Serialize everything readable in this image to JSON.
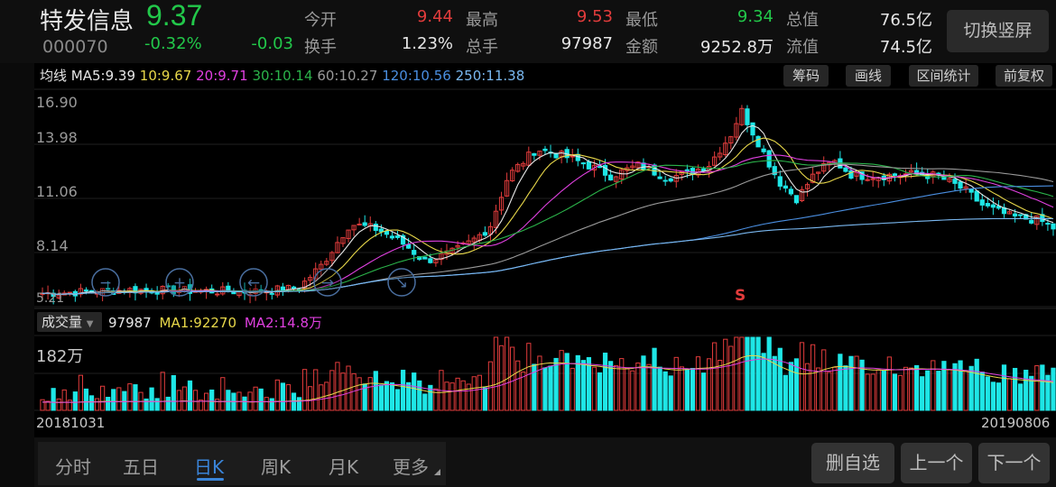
{
  "stock": {
    "name": "特发信息",
    "code": "000070",
    "price": "9.37",
    "change_pct": "-0.32%",
    "change": "-0.03"
  },
  "quote": [
    {
      "label": "今开",
      "value": "9.44",
      "color": "#e23c3c"
    },
    {
      "label": "最高",
      "value": "9.53",
      "color": "#e23c3c"
    },
    {
      "label": "最低",
      "value": "9.34",
      "color": "#22c84a"
    },
    {
      "label": "总值",
      "value": "76.5亿",
      "color": "#e6e6e6"
    },
    {
      "label": "换手",
      "value": "1.23%",
      "color": "#e6e6e6"
    },
    {
      "label": "总手",
      "value": "97987",
      "color": "#e6e6e6"
    },
    {
      "label": "金额",
      "value": "9252.8万",
      "color": "#e6e6e6"
    },
    {
      "label": "流值",
      "value": "74.5亿",
      "color": "#e6e6e6"
    }
  ],
  "switch_label": "切换竖屏",
  "ma_legend": {
    "title": "均线",
    "items": [
      {
        "text": "MA5:9.39",
        "color": "#e6e6e6"
      },
      {
        "text": "10:9.67",
        "color": "#e8d84a"
      },
      {
        "text": "20:9.71",
        "color": "#e040e0"
      },
      {
        "text": "30:10.14",
        "color": "#2bb34a"
      },
      {
        "text": "60:10.27",
        "color": "#9a9a9a"
      },
      {
        "text": "120:10.56",
        "color": "#4a8ee0"
      },
      {
        "text": "250:11.38",
        "color": "#7ab8f0"
      }
    ]
  },
  "tools": [
    "筹码",
    "画线",
    "区间统计",
    "前复权"
  ],
  "price_axis": [
    "16.90",
    "13.98",
    "11.06",
    "8.14",
    "5.21"
  ],
  "signal_marker": "S",
  "volume": {
    "selector": "成交量",
    "value": "97987",
    "ma1": "MA1:92270",
    "ma2": "MA2:14.8万",
    "axis_max": "182万"
  },
  "dates": {
    "start": "20181031",
    "end": "20190806"
  },
  "period_tabs": [
    "分时",
    "五日",
    "日K",
    "周K",
    "月K",
    "更多"
  ],
  "active_tab": "日K",
  "action_buttons": [
    "删自选",
    "上一个",
    "下一个"
  ],
  "colors": {
    "up": "#e23c3c",
    "down": "#1ee6e6",
    "green": "#22c84a",
    "accent": "#3a84d8"
  },
  "chart_data": {
    "type": "candlestick",
    "range": [
      "20181031",
      "20190806"
    ],
    "ylim": [
      5.21,
      16.9
    ],
    "volume_max": "182万",
    "last_close": 9.37
  }
}
